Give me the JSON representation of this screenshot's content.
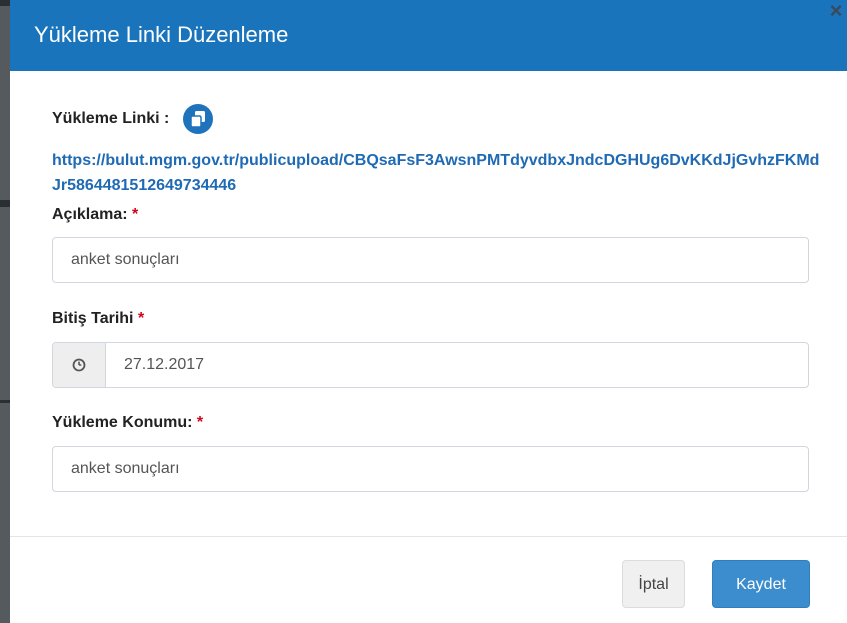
{
  "dialog": {
    "title": "Yükleme Linki Düzenleme",
    "close_glyph": "×"
  },
  "link": {
    "label": "Yükleme Linki :",
    "url": "https://bulut.mgm.gov.tr/publicupload/CBQsaFsF3AwsnPMTdyvdbxJndcDGHUg6DvKKdJjGvhzFKMdJr5864481512649734446",
    "copy_icon": "copy-icon"
  },
  "fields": {
    "aciklama": {
      "label": "Açıklama:",
      "required": "*",
      "value": "anket sonuçları"
    },
    "bitis": {
      "label": "Bitiş Tarihi",
      "required": "*",
      "value": "27.12.2017",
      "icon": "clock-icon"
    },
    "konum": {
      "label": "Yükleme Konumu:",
      "required": "*",
      "value": "anket sonuçları"
    }
  },
  "footer": {
    "cancel_label": "İptal",
    "save_label": "Kaydet"
  },
  "colors": {
    "header": "#1a74bb",
    "link": "#1f6ab4",
    "required": "#d0021b",
    "save_button": "#3c8dcd"
  }
}
